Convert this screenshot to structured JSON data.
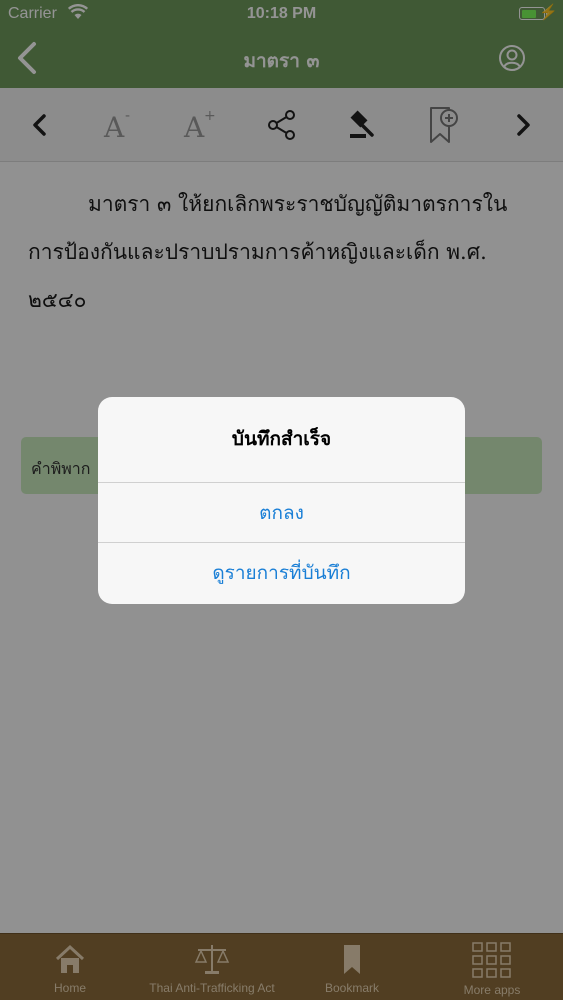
{
  "status": {
    "carrier": "Carrier",
    "time": "10:18 PM"
  },
  "nav": {
    "title": "มาตรา ๓"
  },
  "section": {
    "text": "มาตรา ๓ ให้ยกเลิกพระราชบัญญัติมาตรการในการป้องกันและปราบปรามการค้าหญิงและเด็ก พ.ศ. ๒๕๔๐"
  },
  "verdict": {
    "label": "คำพิพาก"
  },
  "tabs": [
    {
      "label": "Home",
      "icon": "home-icon"
    },
    {
      "label": "Thai Anti-Trafficking Act",
      "icon": "scales-icon"
    },
    {
      "label": "Bookmark",
      "icon": "bookmark-icon"
    },
    {
      "label": "More apps",
      "icon": "grid-icon"
    }
  ],
  "alert": {
    "title": "บันทึกสำเร็จ",
    "ok_label": "ตกลง",
    "view_label": "ดูรายการที่บันทึก"
  },
  "colors": {
    "header": "#6f9a5c",
    "tabbar": "#8c6c3b",
    "accent": "#1a7fd6",
    "verdict_bg": "#c8e8bc"
  }
}
